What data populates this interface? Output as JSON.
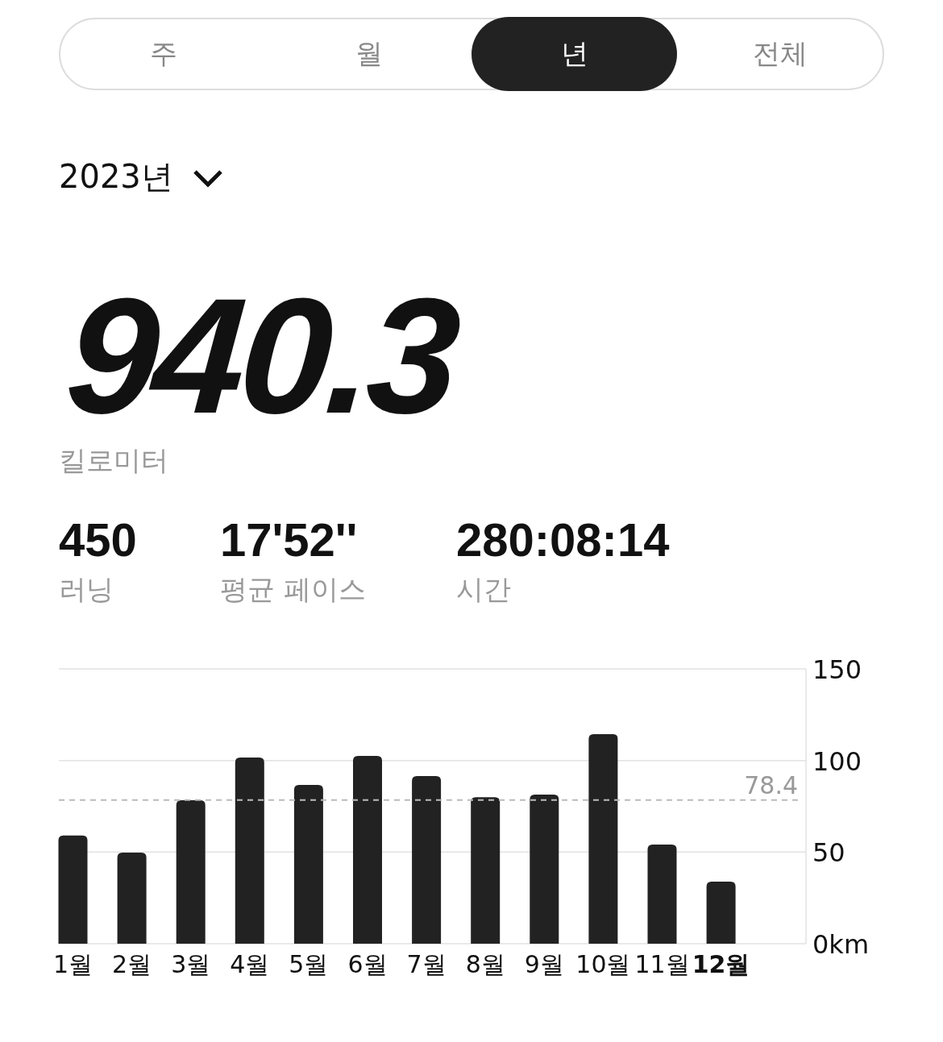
{
  "tabs": [
    {
      "label": "주",
      "selected": false
    },
    {
      "label": "월",
      "selected": false
    },
    {
      "label": "년",
      "selected": true
    },
    {
      "label": "전체",
      "selected": false
    }
  ],
  "period": {
    "label": "2023년"
  },
  "total": {
    "value": "940.3",
    "unit": "킬로미터"
  },
  "stats": [
    {
      "value": "450",
      "label": "러닝"
    },
    {
      "value": "17'52''",
      "label": "평균 페이스"
    },
    {
      "value": "280:08:14",
      "label": "시간"
    }
  ],
  "chart_data": {
    "type": "bar",
    "categories": [
      "1월",
      "2월",
      "3월",
      "4월",
      "5월",
      "6월",
      "7월",
      "8월",
      "9월",
      "10월",
      "11월",
      "12월"
    ],
    "values": [
      59,
      49.7,
      78.3,
      101.6,
      86.7,
      102.5,
      91.5,
      80,
      81.4,
      114.4,
      54.1,
      33.9
    ],
    "ylim": [
      0,
      150
    ],
    "yticks": [
      {
        "value": 0,
        "label": "0km"
      },
      50,
      100,
      150
    ],
    "ref_lines": [
      {
        "axis": "y",
        "value": 78.4,
        "label": "78.4"
      }
    ]
  },
  "month_selected": [
    false,
    false,
    false,
    false,
    false,
    false,
    false,
    false,
    false,
    false,
    false,
    true
  ]
}
